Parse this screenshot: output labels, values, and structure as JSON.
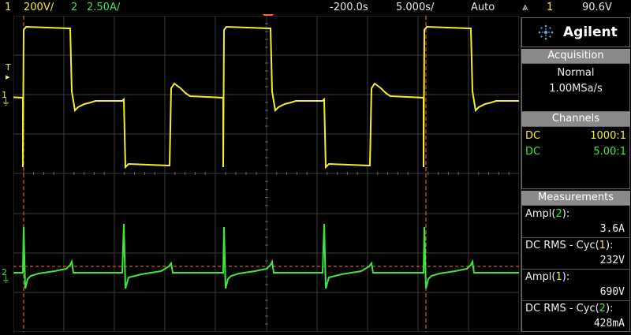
{
  "topbar": {
    "ch1_num": "1",
    "ch1_scale": "200V/",
    "ch2_num": "2",
    "ch2_scale": "2.50A/",
    "time_delay": "-200.0s",
    "time_scale": "5.000s/",
    "trigger_mode": "Auto",
    "trigger_icon": "trigger-edge-icon",
    "trigger_source": "1",
    "trigger_level": "90.6V"
  },
  "screen_markers": {
    "trigger_label": "T",
    "ch1_label": "1",
    "ch2_label": "2"
  },
  "panel": {
    "brand": "Agilent",
    "acquisition": {
      "title": "Acquisition",
      "mode": "Normal",
      "rate": "1.00MSa/s"
    },
    "channels": {
      "title": "Channels",
      "items": [
        {
          "coupling": "DC",
          "probe": "1000:1",
          "color": "#f2ef2a"
        },
        {
          "coupling": "DC",
          "probe": "5.00:1",
          "color": "#3ee63e"
        }
      ]
    },
    "measurements": {
      "title": "Measurements",
      "items": [
        {
          "label_pre": "Ampl(",
          "label_ch": "2",
          "label_post": "):",
          "value": "3.6A",
          "ch_color": "#3ee63e"
        },
        {
          "label_pre": "DC RMS - Cyc(",
          "label_ch": "1",
          "label_post": "):",
          "value": "232V",
          "ch_color": "#f2ef2a"
        },
        {
          "label_pre": "Ampl(",
          "label_ch": "1",
          "label_post": "):",
          "value": "690V",
          "ch_color": "#f2ef2a"
        },
        {
          "label_pre": "DC RMS - Cyc(",
          "label_ch": "2",
          "label_post": "):",
          "value": "428mA",
          "ch_color": "#3ee63e"
        }
      ]
    }
  },
  "colors": {
    "ch1": "#f2ef2a",
    "ch2": "#3ee63e",
    "cursor": "#ff6a1a"
  }
}
